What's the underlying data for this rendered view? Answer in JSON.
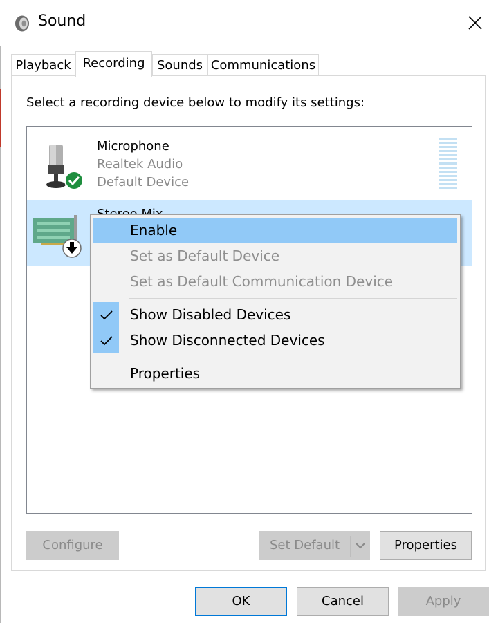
{
  "window": {
    "title": "Sound",
    "close_icon": "close-icon"
  },
  "tabs": [
    {
      "label": "Playback",
      "active": false
    },
    {
      "label": "Recording",
      "active": true
    },
    {
      "label": "Sounds",
      "active": false
    },
    {
      "label": "Communications",
      "active": false
    }
  ],
  "instructions": "Select a recording device below to modify its settings:",
  "devices": [
    {
      "name": "Microphone",
      "driver": "Realtek Audio",
      "status": "Default Device",
      "icon": "microphone-icon",
      "badge": "green-check-badge"
    },
    {
      "name": "Stereo Mix",
      "icon": "sound-card-icon",
      "badge": "disabled-arrow-badge",
      "selected": true
    }
  ],
  "context_menu": {
    "items": [
      {
        "label": "Enable",
        "highlighted": true,
        "enabled": true
      },
      {
        "label": "Set as Default Device",
        "enabled": false
      },
      {
        "label": "Set as Default Communication Device",
        "enabled": false
      },
      {
        "label": "Show Disabled Devices",
        "checked": true,
        "enabled": true
      },
      {
        "label": "Show Disconnected Devices",
        "checked": true,
        "enabled": true
      },
      {
        "label": "Properties",
        "enabled": true
      }
    ]
  },
  "buttons": {
    "configure": "Configure",
    "set_default": "Set Default",
    "properties": "Properties",
    "ok": "OK",
    "cancel": "Cancel",
    "apply": "Apply"
  },
  "colors": {
    "selection": "#cce8ff",
    "menu_highlight": "#91c9f7",
    "default_button_border": "#0078d7",
    "status_check": "#1e8e3e"
  }
}
